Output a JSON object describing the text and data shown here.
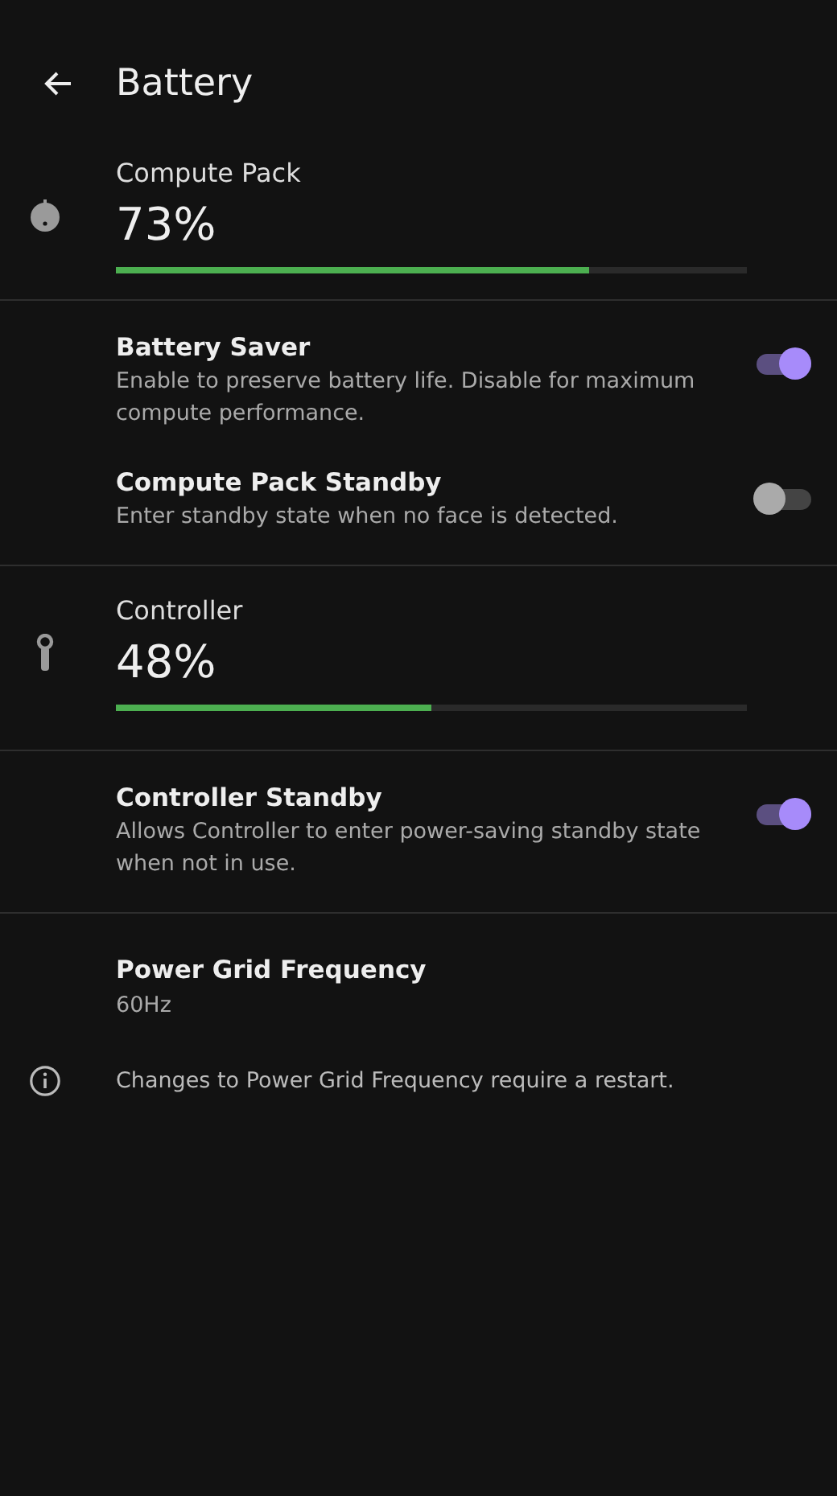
{
  "header": {
    "title": "Battery"
  },
  "groups": [
    {
      "items": [
        {
          "kind": "device",
          "name": "Compute Pack",
          "percent": "73%",
          "level": 0.75
        }
      ]
    },
    {
      "items": [
        {
          "kind": "toggle",
          "title": "Battery Saver",
          "description": "Enable to preserve battery life. Disable for maximum compute performance.",
          "on": true
        },
        {
          "kind": "toggle",
          "title": "Compute Pack Standby",
          "description": "Enter standby state when no face is detected.",
          "on": false
        }
      ]
    },
    {
      "items": [
        {
          "kind": "device",
          "name": "Controller",
          "percent": "48%",
          "level": 0.5
        }
      ]
    },
    {
      "items": [
        {
          "kind": "toggle",
          "title": "Controller Standby",
          "description": "Allows Controller to enter power-saving standby state when not in use.",
          "on": true
        }
      ]
    },
    {
      "items": [
        {
          "kind": "value",
          "title": "Power Grid Frequency",
          "value": "60Hz"
        },
        {
          "kind": "info",
          "text": "Changes to Power Grid Frequency require a restart."
        }
      ]
    }
  ]
}
